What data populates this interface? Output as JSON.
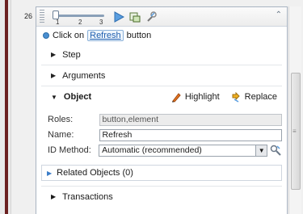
{
  "step_number": "26",
  "slider": {
    "ticks": [
      "1",
      "2",
      "3"
    ]
  },
  "icons": {
    "play": "play-icon",
    "capture": "capture-icon",
    "settings": "wrench-icon",
    "collapse": "collapse-icon"
  },
  "step_description": {
    "prefix": "Click on",
    "target": "Refresh",
    "suffix": "button"
  },
  "sections": {
    "step": "Step",
    "arguments": "Arguments",
    "object": "Object",
    "transactions": "Transactions"
  },
  "object_actions": {
    "highlight": "Highlight",
    "replace": "Replace"
  },
  "object_form": {
    "roles_label": "Roles:",
    "roles_value": "button,element",
    "name_label": "Name:",
    "name_value": "Refresh",
    "id_method_label": "ID Method:",
    "id_method_value": "Automatic (recommended)"
  },
  "related_objects": "Related Objects (0)",
  "colors": {
    "link": "#2060b0",
    "accent": "#3a7cc8",
    "border": "#a9b4c2"
  }
}
